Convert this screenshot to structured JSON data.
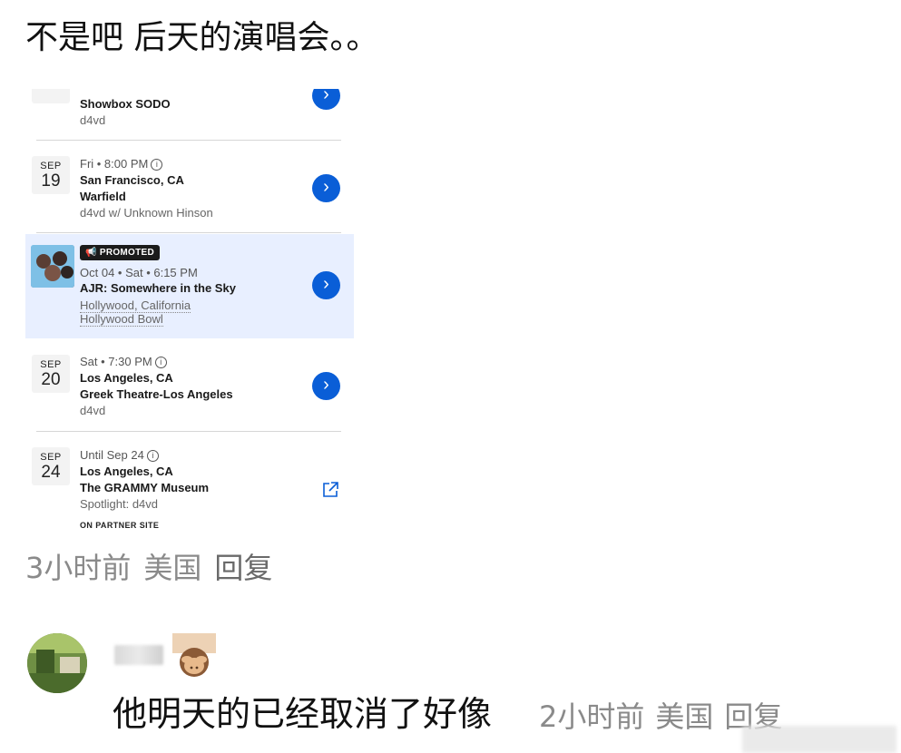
{
  "post": {
    "text": "不是吧 后天的演唱会。。"
  },
  "listing": {
    "top_partial": {
      "venue": "Showbox SODO",
      "artist": "d4vd"
    },
    "events": [
      {
        "month": "SEP",
        "day": "19",
        "meta": "Fri • 8:00 PM",
        "city": "San Francisco, CA",
        "venue": "Warfield",
        "sub": "d4vd w/ Unknown Hinson"
      },
      {
        "promoted_label": "PROMOTED",
        "meta": "Oct 04 • Sat • 6:15 PM",
        "title": "AJR: Somewhere in the Sky",
        "location": "Hollywood, California",
        "venue": "Hollywood Bowl"
      },
      {
        "month": "SEP",
        "day": "20",
        "meta": "Sat • 7:30 PM",
        "city": "Los Angeles, CA",
        "venue": "Greek Theatre-Los Angeles",
        "sub": "d4vd"
      },
      {
        "month": "SEP",
        "day": "24",
        "meta": "Until Sep 24",
        "city": "Los Angeles, CA",
        "venue": "The GRAMMY Museum",
        "sub": "Spotlight: d4vd",
        "partner": "ON PARTNER SITE"
      }
    ],
    "icons": {
      "info": "info-icon",
      "arrow": "chevron-right-icon",
      "external": "external-link-icon",
      "megaphone": "megaphone-icon"
    },
    "accent": "#0a5ed7",
    "promoted_bg": "#e8efff"
  },
  "post_meta": {
    "time": "3小时前",
    "location": "美国",
    "reply": "回复"
  },
  "reply": {
    "text": "他明天的已经取消了好像",
    "time": "2小时前",
    "location": "美国",
    "reply": "回复"
  }
}
